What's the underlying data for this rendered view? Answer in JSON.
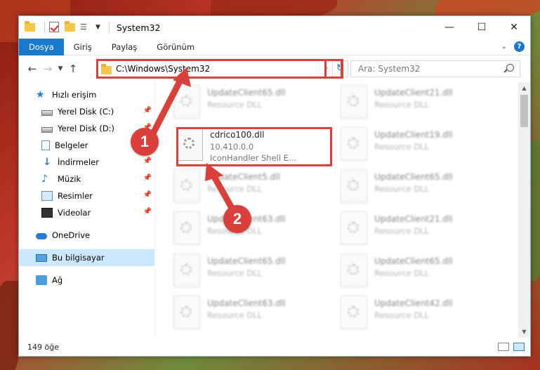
{
  "window": {
    "title": "System32",
    "controls": {
      "minimize": "—",
      "maximize": "☐",
      "close": "✕"
    }
  },
  "ribbon": {
    "tabs": [
      {
        "label": "Dosya",
        "active": true
      },
      {
        "label": "Giriş"
      },
      {
        "label": "Paylaş"
      },
      {
        "label": "Görünüm"
      }
    ]
  },
  "address": {
    "path": "C:\\Windows\\System32",
    "search_placeholder": "Ara: System32"
  },
  "sidebar": {
    "items": [
      {
        "label": "Hızlı erişim",
        "icon": "star-icon"
      },
      {
        "label": "Yerel Disk (C:)",
        "icon": "drive-icon",
        "pinned": true
      },
      {
        "label": "Yerel Disk (D:)",
        "icon": "drive-icon",
        "pinned": true
      },
      {
        "label": "Belgeler",
        "icon": "document-icon",
        "pinned": true
      },
      {
        "label": "İndirmeler",
        "icon": "download-icon",
        "pinned": true
      },
      {
        "label": "Müzik",
        "icon": "music-icon",
        "pinned": true
      },
      {
        "label": "Resimler",
        "icon": "pictures-icon",
        "pinned": true
      },
      {
        "label": "Videolar",
        "icon": "video-icon",
        "pinned": true
      },
      {
        "label": "OneDrive",
        "icon": "cloud-icon"
      },
      {
        "label": "Bu bilgisayar",
        "icon": "computer-icon",
        "selected": true
      },
      {
        "label": "Ağ",
        "icon": "network-icon"
      }
    ]
  },
  "files": {
    "focused": {
      "name": "cdrico100.dll",
      "version": "10.410.0.0",
      "description": "IconHandler Shell E..."
    },
    "blurred": [
      {
        "name": "UpdateClient65.dll",
        "desc": "Resource DLL"
      },
      {
        "name": "UpdateClient21.dll",
        "desc": "Resource DLL"
      },
      {
        "name": "UpdateClient19.dll",
        "desc": "Resource DLL"
      },
      {
        "name": "UpdateClient5.dll",
        "desc": "Resource DLL"
      },
      {
        "name": "UpdateClient65.dll",
        "desc": "Resource DLL"
      },
      {
        "name": "UpdateClient63.dll",
        "desc": "Resource DLL"
      },
      {
        "name": "UpdateClient21.dll",
        "desc": "Resource DLL"
      },
      {
        "name": "UpdateClient65.dll",
        "desc": "Resource DLL"
      },
      {
        "name": "UpdateClient65.dll",
        "desc": "Resource DLL"
      },
      {
        "name": "UpdateClient63.dll",
        "desc": "Resource DLL"
      },
      {
        "name": "UpdateClient42.dll",
        "desc": "Resource DLL"
      }
    ]
  },
  "status": {
    "count": "149 öğe"
  },
  "callouts": {
    "one": "1",
    "two": "2"
  },
  "colors": {
    "accent": "#1979ca",
    "highlight": "#d9403c",
    "selected": "#cce8ff"
  }
}
